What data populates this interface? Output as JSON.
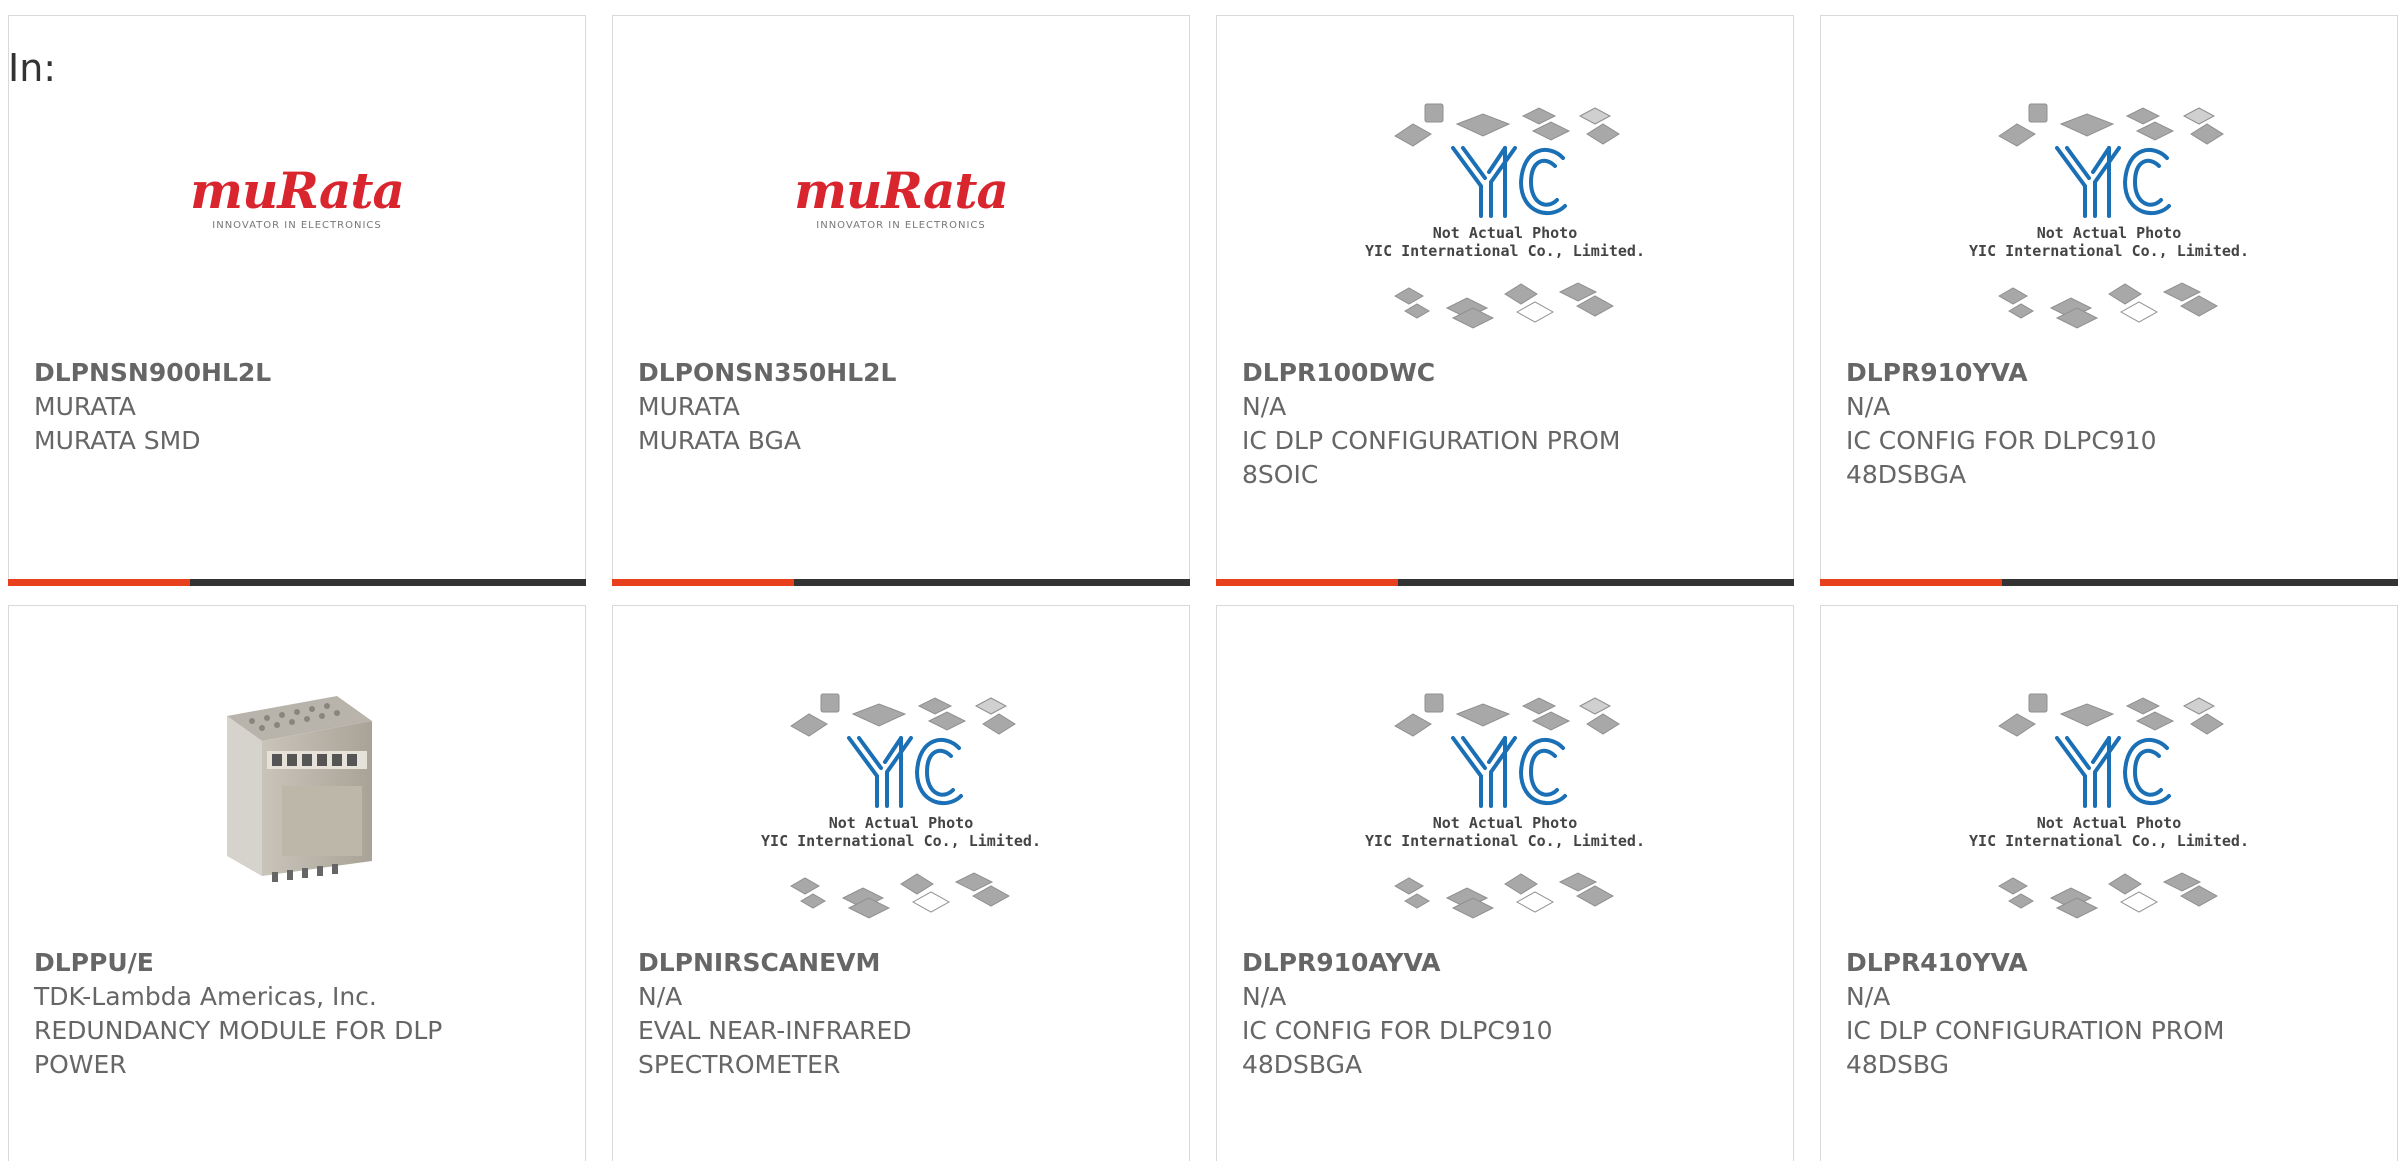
{
  "header": {
    "in_label": "In:"
  },
  "placeholder": {
    "line1": "Not Actual Photo",
    "line2": "YIC International Co., Limited.",
    "logo_text": "YIC"
  },
  "brand_logo": {
    "word": "muRata",
    "tagline": "INNOVATOR IN ELECTRONICS"
  },
  "colors": {
    "accent": "#e8401c",
    "bar": "#333333",
    "murata_red": "#d9252e",
    "yic_blue": "#1a6fb5"
  },
  "products": [
    {
      "part": "DLPNSN900HL2L",
      "maker": "MURATA",
      "desc1": "MURATA SMD",
      "desc2": "",
      "image": "murata-logo"
    },
    {
      "part": "DLPONSN350HL2L",
      "maker": "MURATA",
      "desc1": "MURATA BGA",
      "desc2": "",
      "image": "murata-logo"
    },
    {
      "part": "DLPR100DWC",
      "maker": "N/A",
      "desc1": "IC DLP CONFIGURATION PROM",
      "desc2": "8SOIC",
      "image": "yic-placeholder"
    },
    {
      "part": "DLPR910YVA",
      "maker": "N/A",
      "desc1": "IC CONFIG FOR DLPC910",
      "desc2": "48DSBGA",
      "image": "yic-placeholder"
    },
    {
      "part": "DLPPU/E",
      "maker": "TDK-Lambda Americas, Inc.",
      "desc1": "REDUNDANCY MODULE FOR DLP",
      "desc2": "POWER",
      "image": "power-module"
    },
    {
      "part": "DLPNIRSCANEVM",
      "maker": "N/A",
      "desc1": "EVAL NEAR-INFRARED",
      "desc2": "SPECTROMETER",
      "image": "yic-placeholder"
    },
    {
      "part": "DLPR910AYVA",
      "maker": "N/A",
      "desc1": "IC CONFIG FOR DLPC910",
      "desc2": "48DSBGA",
      "image": "yic-placeholder"
    },
    {
      "part": "DLPR410YVA",
      "maker": "N/A",
      "desc1": "IC DLP CONFIGURATION PROM",
      "desc2": "48DSBG",
      "image": "yic-placeholder"
    }
  ]
}
